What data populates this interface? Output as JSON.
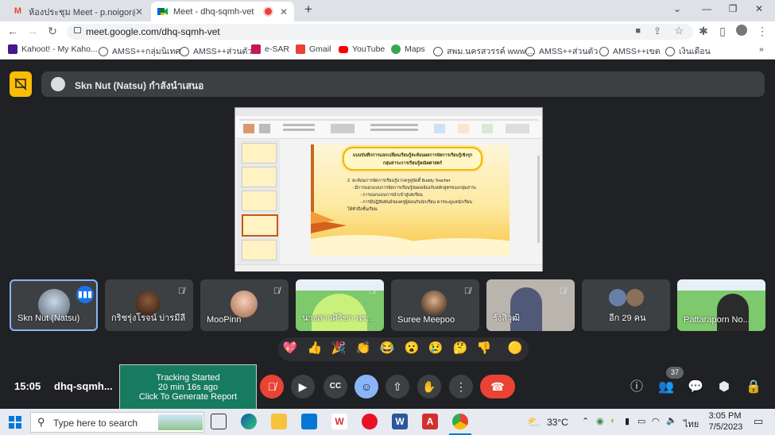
{
  "browser": {
    "tabs": [
      {
        "title": "ห้องประชุม Meet - p.noigor@gma",
        "active": false
      },
      {
        "title": "Meet - dhq-sqmh-vet",
        "active": true
      }
    ],
    "new_tab_symbol": "+",
    "url": "meet.google.com/dhq-sqmh-vet"
  },
  "bookmarks": [
    {
      "label": "Kahoot! - My Kaho...",
      "icon": "kahoot-icon"
    },
    {
      "label": "AMSS++กลุ่มนิเทศ",
      "icon": "globe-icon"
    },
    {
      "label": "AMSS++ส่วนตัว",
      "icon": "globe-icon"
    },
    {
      "label": "e-SAR",
      "icon": "esar-icon"
    },
    {
      "label": "Gmail",
      "icon": "gmail-icon"
    },
    {
      "label": "YouTube",
      "icon": "youtube-icon"
    },
    {
      "label": "Maps",
      "icon": "maps-icon"
    },
    {
      "label": "สพม.นครสวรรค์ www....",
      "icon": "globe-icon"
    },
    {
      "label": "AMSS++ส่วนตัว",
      "icon": "globe-icon"
    },
    {
      "label": "AMSS++เขต",
      "icon": "globe-icon"
    },
    {
      "label": "เงินเดือน",
      "icon": "globe-icon"
    }
  ],
  "meet": {
    "presenter_text": "Skn Nut (Natsu) กำลังนำเสนอ",
    "slide": {
      "title_line1": "แบบบันทึกการแลกเปลี่ยนเรียนรู้สะท้อนผลการจัดการเรียนรู้เชิงรุก",
      "title_line2": "กลุ่มสาระการเรียนรู้คณิตศาสตร์",
      "body": [
        "2. สะท้อนการจัดการเรียนรู้จากครูคู่บัดดี้ Buddy Teacher",
        "- มีการออกแบบการจัดการเรียนรู้สอดคล้องกับหลักสูตรของกลุ่มสาระ",
        "- การออกแบบการนำเข้าสู่บทเรียน",
        "- การมีปฏิสัมพันธ์ของครูผู้สอนกับนักเรียน ควรจะดูแลนักเรียน",
        "ให้ทั่วถึงชั้นเรียน"
      ]
    },
    "participants": [
      {
        "name": "Skn Nut (Natsu)"
      },
      {
        "name": "กริชรุ่งโรจน์ บ่ารมีลี"
      },
      {
        "name": "MooPinn"
      },
      {
        "name": "นางสาวศิริชา พร..."
      },
      {
        "name": "Suree Meepoo"
      },
      {
        "name": "รังสิวุฒิ"
      },
      {
        "name": "อีก 29 คน"
      },
      {
        "name": "Pattaraporn No..."
      }
    ],
    "reactions": [
      "💖",
      "👍",
      "🎉",
      "👏",
      "😂",
      "😮",
      "😢",
      "🤔",
      "👎",
      "🟡"
    ],
    "clock": "15:05",
    "meeting_code": "dhq-sqmh...",
    "tracking": {
      "line1": "Tracking Started",
      "line2": "20 min 16s ago",
      "line3": "Click To Generate Report"
    },
    "people_count": "37"
  },
  "taskbar": {
    "search_placeholder": "Type here to search",
    "temperature": "33°C",
    "language": "ไทย",
    "time": "3:05 PM",
    "date": "7/5/2023"
  },
  "colors": {
    "meet_bg": "#202124",
    "tile_bg": "#3c4043",
    "present_yellow": "#fbbc04",
    "hangup_red": "#ea4335",
    "reaction_active_blue": "#8ab4f8",
    "tracking_green": "#177b5f"
  }
}
